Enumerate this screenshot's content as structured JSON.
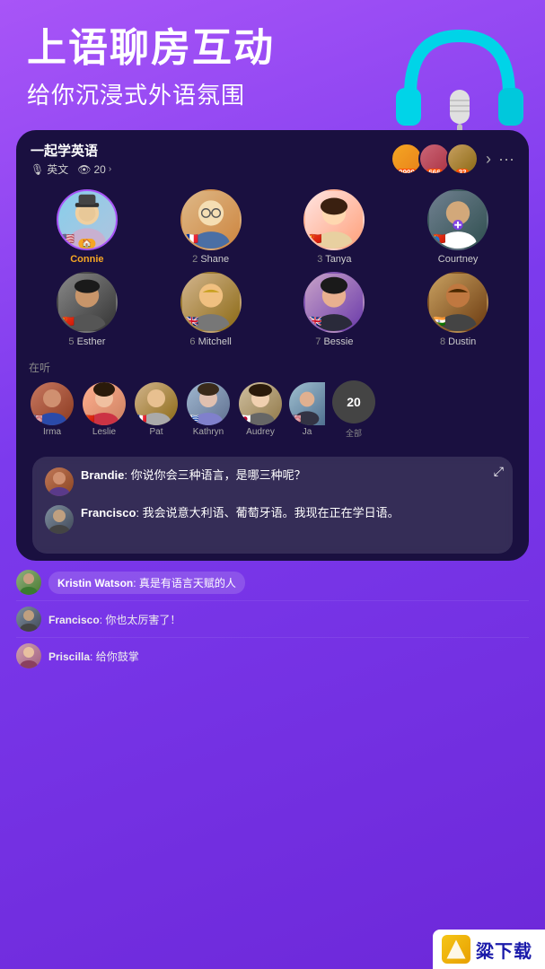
{
  "header": {
    "title": "上语聊房互动",
    "subtitle": "给你沉浸式外语氛围"
  },
  "room": {
    "title": "一起学英语",
    "language": "英文",
    "viewers": "20",
    "viewers_chevron": "›",
    "header_avatars": [
      {
        "id": "ha1",
        "count": "9999",
        "color": "#f5a623"
      },
      {
        "id": "ha2",
        "count": "666",
        "color": "#e54"
      },
      {
        "id": "ha3",
        "count": "33",
        "color": "#888"
      }
    ]
  },
  "speakers": [
    {
      "rank": "",
      "name": "Connie",
      "flag": "🇺🇸",
      "highlight": true,
      "host": true
    },
    {
      "rank": "2",
      "name": "Shane",
      "flag": "🇫🇷",
      "highlight": false
    },
    {
      "rank": "3",
      "name": "Tanya",
      "flag": "🇨🇳",
      "highlight": false
    },
    {
      "rank": "",
      "name": "Courtney",
      "flag": "🇨🇳",
      "highlight": false,
      "user_icon": true
    },
    {
      "rank": "5",
      "name": "Esther",
      "flag": "🇨🇳",
      "highlight": false
    },
    {
      "rank": "6",
      "name": "Mitchell",
      "flag": "🇬🇧",
      "highlight": false
    },
    {
      "rank": "7",
      "name": "Bessie",
      "flag": "🇬🇧",
      "highlight": false
    },
    {
      "rank": "8",
      "name": "Dustin",
      "flag": "🇮🇳",
      "highlight": false
    }
  ],
  "listeners_label": "在听",
  "listeners": [
    {
      "name": "Irma",
      "flag": "🇺🇸"
    },
    {
      "name": "Leslie",
      "flag": "🇨🇳"
    },
    {
      "name": "Pat",
      "flag": "🇫🇷"
    },
    {
      "name": "Kathryn",
      "flag": "🇺🇾"
    },
    {
      "name": "Audrey",
      "flag": "🇯🇵"
    },
    {
      "name": "Ja",
      "flag": "🇺🇸"
    }
  ],
  "listeners_more": "20",
  "listeners_all": "全部",
  "chat": [
    {
      "id": "c1",
      "sender": "Brandie",
      "text": "你说你会三种语言，是哪三种呢？"
    },
    {
      "id": "c2",
      "sender": "Francisco",
      "text": "我会说意大利语、葡萄牙语。我现在正在学日语。"
    }
  ],
  "comments": [
    {
      "id": "cm1",
      "sender": "Kristin Watson",
      "text": "真是有语言天赋的人"
    },
    {
      "id": "cm2",
      "sender": "Francisco",
      "text": "你也太厉害了！"
    },
    {
      "id": "cm3",
      "sender": "Priscilla",
      "text": "给你鼓掌"
    }
  ],
  "watermark": {
    "text": "粱下载"
  },
  "icons": {
    "mic": "🎙",
    "eye": "👁",
    "more": "›",
    "dots": "···",
    "expand": "⤢"
  }
}
